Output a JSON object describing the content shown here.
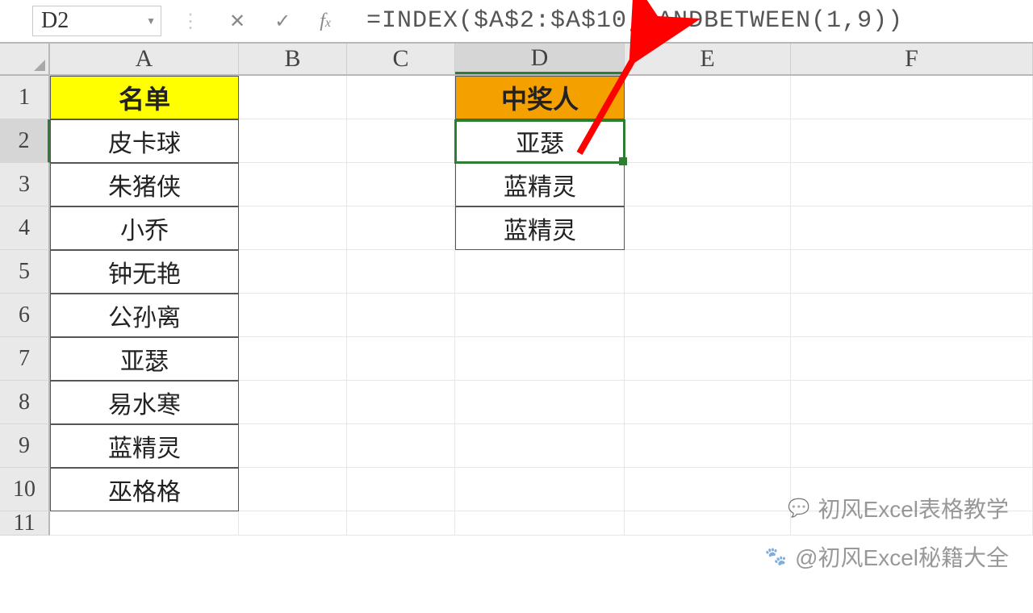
{
  "name_box": "D2",
  "formula": "=INDEX($A$2:$A$10,RANDBETWEEN(1,9))",
  "columns": [
    "A",
    "B",
    "C",
    "D",
    "E",
    "F"
  ],
  "rows": [
    "1",
    "2",
    "3",
    "4",
    "5",
    "6",
    "7",
    "8",
    "9",
    "10",
    "11"
  ],
  "headers": {
    "A1": "名单",
    "D1": "中奖人"
  },
  "colA": [
    "皮卡球",
    "朱猪侠",
    "小乔",
    "钟无艳",
    "公孙离",
    "亚瑟",
    "易水寒",
    "蓝精灵",
    "巫格格"
  ],
  "colD": [
    "亚瑟",
    "蓝精灵",
    "蓝精灵"
  ],
  "watermarks": {
    "w1": "初风Excel表格教学",
    "w2": "@初风Excel秘籍大全"
  }
}
